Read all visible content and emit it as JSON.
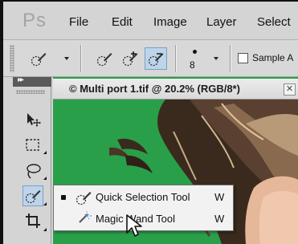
{
  "app": {
    "logo": "Ps"
  },
  "menubar": {
    "items": [
      "File",
      "Edit",
      "Image",
      "Layer",
      "Select"
    ]
  },
  "options": {
    "brush_size": "8",
    "sample_label": "Sample A"
  },
  "document": {
    "title": "© Multi port 1.tif @ 20.2% (RGB/8*)",
    "close_glyph": "✕"
  },
  "flyout": {
    "items": [
      {
        "label": "Quick Selection Tool",
        "shortcut": "W",
        "selected": true
      },
      {
        "label": "Magic Wand Tool",
        "shortcut": "W",
        "selected": false
      }
    ]
  },
  "tools_panel": {
    "collapse_glyph": "▸▸"
  },
  "colors": {
    "green_screen": "#2a9f4a",
    "panel_gray": "#d4d4d4",
    "active_blue": "#bdd4ea"
  },
  "icons": [
    "quick-selection-icon",
    "magic-wand-icon",
    "move-icon",
    "marquee-icon",
    "lasso-icon",
    "crop-icon",
    "mouse-pointer-icon"
  ]
}
